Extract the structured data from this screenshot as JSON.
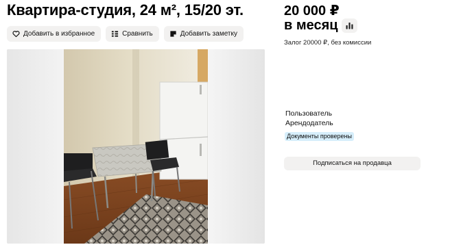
{
  "listing": {
    "title": "Квартира-студия, 24 м², 15/20 эт."
  },
  "actions": {
    "favorite_label": "Добавить в избранное",
    "favorite_icon": "heart-icon",
    "compare_label": "Сравнить",
    "compare_icon": "compare-list-icon",
    "note_label": "Добавить заметку",
    "note_icon": "note-icon"
  },
  "price": {
    "amount": "20 000 ₽",
    "period": "в месяц",
    "stats_icon": "bar-chart-icon",
    "deposit": "Залог 20000 ₽, без комиссии"
  },
  "seller": {
    "name": "Пользователь",
    "role": "Арендодатель",
    "badge": "Документы проверены",
    "badge_color": "#d6eefb",
    "subscribe_label": "Подписаться на продавца"
  }
}
